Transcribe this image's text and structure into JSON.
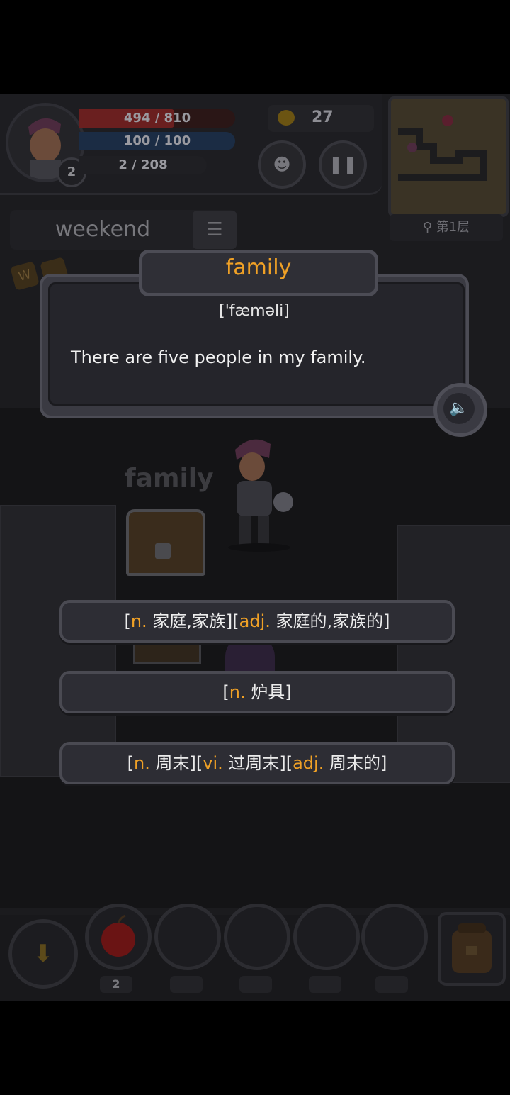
{
  "hud": {
    "hp_text": "494 / 810",
    "hp_fraction": 0.61,
    "mp_text": "100 / 100",
    "exp_text": "2 / 208",
    "level": "2",
    "gold": "27",
    "pet_icon": "demon-face-icon",
    "pause_icon": "pause-icon"
  },
  "minimap": {
    "floor_label": "第1层",
    "search_icon": "magnifier-icon"
  },
  "current_word": {
    "text": "weekend",
    "list_icon": "list-icon"
  },
  "card": {
    "word": "family",
    "phonetic": "['fæməli]",
    "example": "There are five people in my family.",
    "sound_icon": "speaker-icon"
  },
  "scene": {
    "ghost_word": "family"
  },
  "options": [
    {
      "parts": [
        {
          "t": "[",
          "c": "b"
        },
        {
          "t": "n.",
          "c": "p"
        },
        {
          "t": " 家庭,家族][",
          "c": "b"
        },
        {
          "t": "adj.",
          "c": "p"
        },
        {
          "t": " 家庭的,家族的]",
          "c": "b"
        }
      ]
    },
    {
      "parts": [
        {
          "t": "[",
          "c": "b"
        },
        {
          "t": "n.",
          "c": "p"
        },
        {
          "t": " 炉具]",
          "c": "b"
        }
      ]
    },
    {
      "parts": [
        {
          "t": "[",
          "c": "b"
        },
        {
          "t": "n.",
          "c": "p"
        },
        {
          "t": " 周末][",
          "c": "b"
        },
        {
          "t": "vi.",
          "c": "p"
        },
        {
          "t": " 过周末][",
          "c": "b"
        },
        {
          "t": "adj.",
          "c": "p"
        },
        {
          "t": " 周末的]",
          "c": "b"
        }
      ]
    }
  ],
  "inventory": {
    "down_icon": "arrow-down-icon",
    "slot1_item": "apple-icon",
    "slot1_count": "2",
    "bag_icon": "backpack-icon"
  },
  "colors": {
    "accent": "#f0a126",
    "panel": "#2d2d34"
  }
}
